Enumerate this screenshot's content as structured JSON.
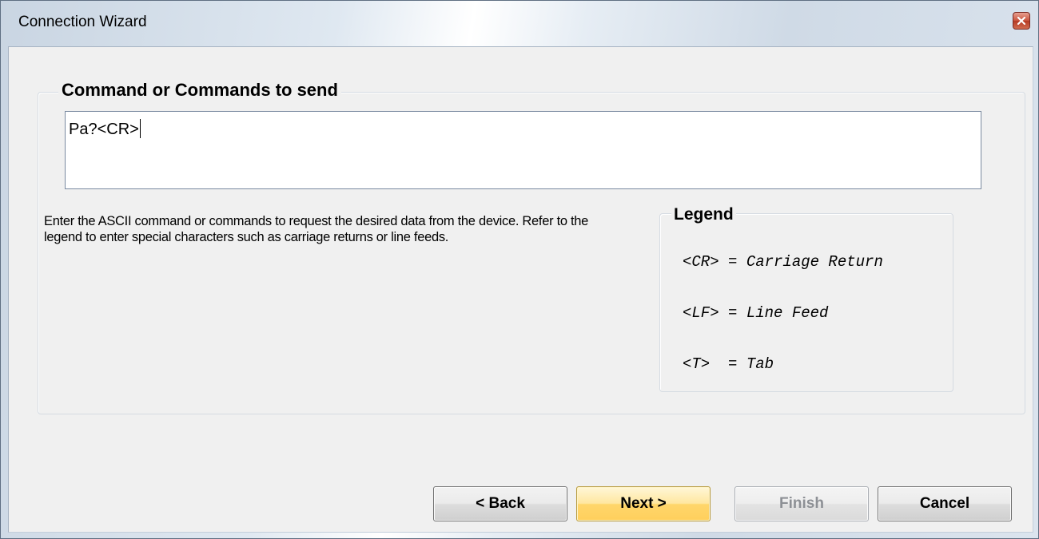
{
  "window": {
    "title": "Connection Wizard"
  },
  "command_group": {
    "title": "Command or Commands to send",
    "input_value": "Pa?<CR>",
    "instructions": "Enter the ASCII command or commands to request the desired data from the device.  Refer to the legend to enter special characters such as carriage returns or line feeds."
  },
  "legend": {
    "title": "Legend",
    "items": [
      "<CR> = Carriage Return",
      "<LF> = Line Feed",
      "<T>  = Tab"
    ]
  },
  "buttons": {
    "back": "< Back",
    "next": "Next >",
    "finish": "Finish",
    "cancel": "Cancel"
  },
  "icons": {
    "close": "close-icon"
  },
  "colors": {
    "default_button": "#ffd66b",
    "close_button": "#c9523c"
  }
}
